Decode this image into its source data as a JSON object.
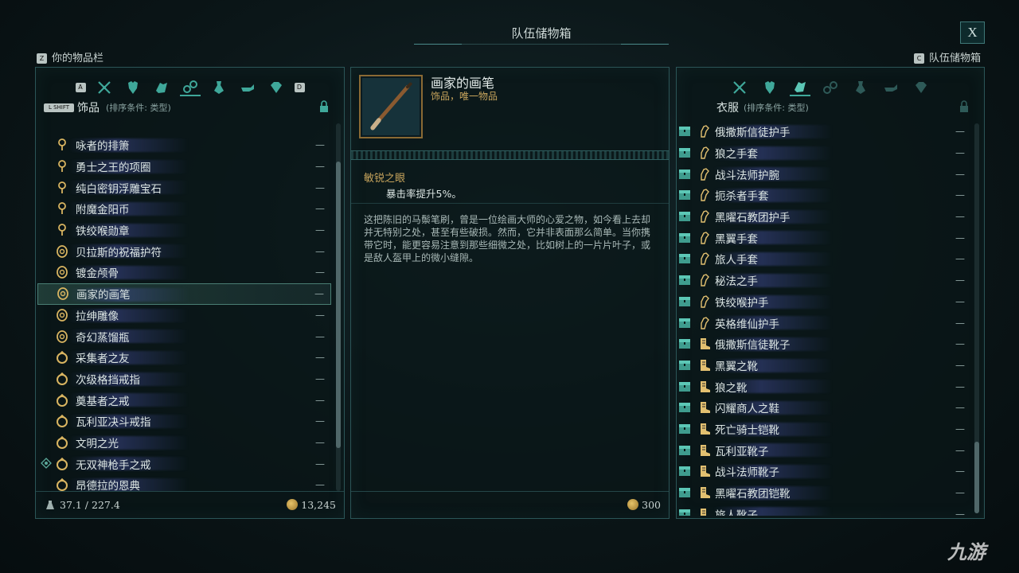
{
  "window_title": "队伍储物箱",
  "close_label": "X",
  "left_link": {
    "key": "Z",
    "label": "你的物品栏"
  },
  "right_link": {
    "key": "C",
    "label": "队伍储物箱"
  },
  "left_panel": {
    "key_prev": "A",
    "key_next": "D",
    "shift_key": "L SHIFT",
    "category": "饰品",
    "sort": "(排序条件: 类型)",
    "items": [
      {
        "name": "咏者的排箫",
        "icon": "amulet-icon",
        "qty": "—"
      },
      {
        "name": "勇士之王的项圈",
        "icon": "amulet-icon",
        "qty": "—"
      },
      {
        "name": "纯白密钥浮雕宝石",
        "icon": "amulet-icon",
        "qty": "—"
      },
      {
        "name": "附魔金阳币",
        "icon": "amulet-icon",
        "qty": "—"
      },
      {
        "name": "铁绞喉勋章",
        "icon": "amulet-icon",
        "qty": "—"
      },
      {
        "name": "贝拉斯的祝福护符",
        "icon": "talisman-icon",
        "qty": "—"
      },
      {
        "name": "镀金颅骨",
        "icon": "talisman-icon",
        "qty": "—"
      },
      {
        "name": "画家的画笔",
        "icon": "talisman-icon",
        "qty": "—",
        "selected": true
      },
      {
        "name": "拉绅雕像",
        "icon": "talisman-icon",
        "qty": "—"
      },
      {
        "name": "奇幻蒸馏瓶",
        "icon": "talisman-icon",
        "qty": "—"
      },
      {
        "name": "采集者之友",
        "icon": "ring-icon",
        "qty": "—"
      },
      {
        "name": "次级格挡戒指",
        "icon": "ring-icon",
        "qty": "—"
      },
      {
        "name": "奠基者之戒",
        "icon": "ring-icon",
        "qty": "—"
      },
      {
        "name": "瓦利亚决斗戒指",
        "icon": "ring-icon",
        "qty": "—"
      },
      {
        "name": "文明之光",
        "icon": "ring-icon",
        "qty": "—"
      },
      {
        "name": "无双神枪手之戒",
        "icon": "ring-icon",
        "qty": "—",
        "marked": true
      },
      {
        "name": "昂德拉的恩典",
        "icon": "ring-icon",
        "qty": "—"
      }
    ],
    "weight": "37.1 / 227.4",
    "gold": "13,245"
  },
  "detail": {
    "title": "画家的画笔",
    "subtitle": "饰品，唯一物品",
    "trait_name": "敏锐之眼",
    "trait_desc": "暴击率提升5%。",
    "description": "这把陈旧的马鬃笔刷，曾是一位绘画大师的心爱之物，如今看上去却并无特别之处，甚至有些破损。然而，它并非表面那么简单。当你携带它时，能更容易注意到那些细微之处，比如树上的一片片叶子，或是敌人盔甲上的微小缝隙。",
    "value": "300"
  },
  "right_panel": {
    "category": "衣服",
    "sort": "(排序条件: 类型)",
    "items": [
      {
        "name": "俄撒斯信徒护手",
        "icon": "gloves-icon",
        "qty": "—"
      },
      {
        "name": "狼之手套",
        "icon": "gloves-icon",
        "qty": "—"
      },
      {
        "name": "战斗法师护腕",
        "icon": "gloves-icon",
        "qty": "—"
      },
      {
        "name": "扼杀者手套",
        "icon": "gloves-icon",
        "qty": "—"
      },
      {
        "name": "黑曜石教团护手",
        "icon": "gloves-icon",
        "qty": "—"
      },
      {
        "name": "黑翼手套",
        "icon": "gloves-icon",
        "qty": "—"
      },
      {
        "name": "旅人手套",
        "icon": "gloves-icon",
        "qty": "—"
      },
      {
        "name": "秘法之手",
        "icon": "gloves-icon",
        "qty": "—"
      },
      {
        "name": "铁绞喉护手",
        "icon": "gloves-icon",
        "qty": "—"
      },
      {
        "name": "英格维仙护手",
        "icon": "gloves-icon",
        "qty": "—"
      },
      {
        "name": "俄撒斯信徒靴子",
        "icon": "boots-icon",
        "qty": "—"
      },
      {
        "name": "黑翼之靴",
        "icon": "boots-icon",
        "qty": "—"
      },
      {
        "name": "狼之靴",
        "icon": "boots-icon",
        "qty": "—"
      },
      {
        "name": "闪耀商人之鞋",
        "icon": "boots-icon",
        "qty": "—"
      },
      {
        "name": "死亡骑士铠靴",
        "icon": "boots-icon",
        "qty": "—"
      },
      {
        "name": "瓦利亚靴子",
        "icon": "boots-icon",
        "qty": "—"
      },
      {
        "name": "战斗法师靴子",
        "icon": "boots-icon",
        "qty": "—"
      },
      {
        "name": "黑曜石教团铠靴",
        "icon": "boots-icon",
        "qty": "—"
      },
      {
        "name": "旅人靴子",
        "icon": "boots-icon",
        "qty": "—"
      }
    ]
  },
  "colors": {
    "accent": "#3fa89a",
    "gold": "#c7a45c",
    "panel_border": "#2b5557"
  },
  "watermark": "九游"
}
